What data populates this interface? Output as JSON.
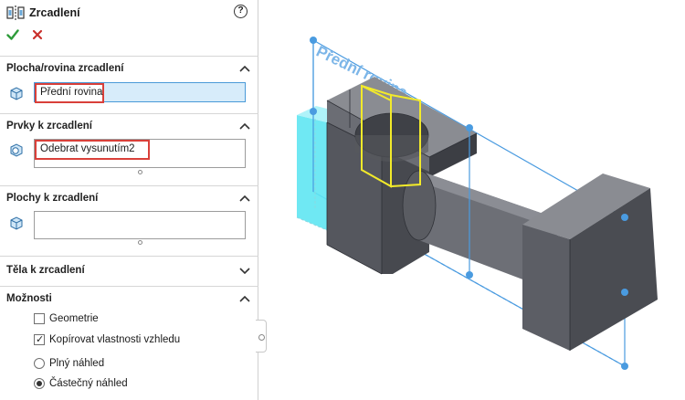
{
  "header": {
    "title": "Zrcadlení",
    "help": "?",
    "icons": {
      "feature": "mirror-feature-icon",
      "ok": "check-icon",
      "cancel": "close-icon"
    }
  },
  "sections": {
    "plane": {
      "label": "Plocha/rovina zrcadlení",
      "selection": "Přední rovina"
    },
    "features": {
      "label": "Prvky k zrcadlení",
      "selection": "Odebrat vysunutím2"
    },
    "faces": {
      "label": "Plochy k zrcadlení",
      "selection": ""
    },
    "bodies": {
      "label": "Těla k zrcadlení"
    },
    "options": {
      "label": "Možnosti",
      "geometry": {
        "label": "Geometrie",
        "checked": false
      },
      "copy_appearance": {
        "label": "Kopírovat vlastnosti vzhledu",
        "checked": true
      },
      "full_preview": {
        "label": "Plný náhled",
        "selected": false
      },
      "partial_preview": {
        "label": "Částečný náhled",
        "selected": true
      }
    }
  },
  "viewport": {
    "plane_label": "Přední rovina",
    "colors": {
      "plane": "#4a9be0",
      "selection": "#f2ea2a",
      "highlight": "#5fe6f2",
      "body": "#5d5f66"
    }
  }
}
